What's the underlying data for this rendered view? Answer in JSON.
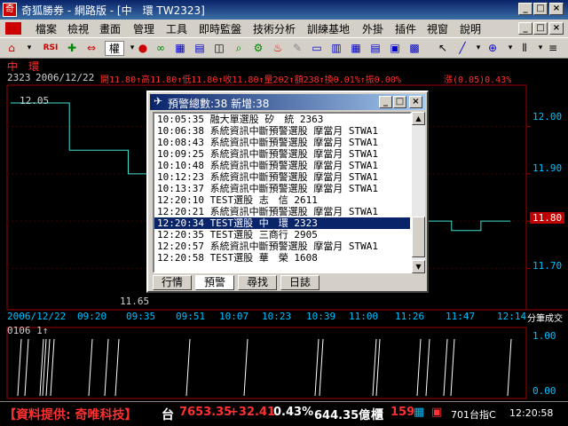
{
  "window": {
    "title": "奇狐勝券 - 網路版 - [中　環 TW2323]"
  },
  "menu": [
    "檔案",
    "檢視",
    "畫面",
    "管理",
    "工具",
    "即時監盤",
    "技術分析",
    "訓練基地",
    "外掛",
    "插件",
    "視窗",
    "說明"
  ],
  "toolbar": {
    "period_label": "權"
  },
  "chart_header": {
    "stock_name": "中　環",
    "code": "2323",
    "date": "2006/12/22",
    "ohlc_text": "開11.80↑高11.80↑低11.80↑收11.80↑量202↑額238↑換0.01%↑振0.00%",
    "change_text": "漲(0.05)0.43%"
  },
  "price_axis": {
    "labels": [
      "12.00",
      "11.90",
      "11.80",
      "11.70"
    ],
    "current_price": "11.80",
    "high_marker": "12.05",
    "low_marker": "11.65"
  },
  "time_axis": {
    "start_date": "2006/12/22",
    "ticks": [
      "09:20",
      "09:35",
      "09:51",
      "10:07",
      "10:23",
      "10:39",
      "11:00",
      "11:26",
      "11:47",
      "12:14"
    ],
    "right_label": "分筆成交"
  },
  "volume_panel": {
    "header": "0106 1↑",
    "labels": [
      "1.00",
      "0.00"
    ]
  },
  "chart_data": {
    "type": "line",
    "series": [
      {
        "values": [
          12.05,
          12.05,
          11.95,
          11.95,
          11.9,
          11.9,
          11.82,
          11.82,
          11.8,
          11.8,
          11.72,
          11.66,
          11.7,
          11.78,
          11.8,
          11.78,
          11.8,
          11.8
        ]
      }
    ],
    "ylim": [
      11.62,
      12.08
    ]
  },
  "dialog": {
    "title": "預警總數:38 新增:38",
    "rows": [
      "10:05:35 融大單選股 矽　統 2363",
      "10:06:38 系統資訊中斷預警選股 摩當月 STWA1",
      "10:08:43 系統資訊中斷預警選股 摩當月 STWA1",
      "10:09:25 系統資訊中斷預警選股 摩當月 STWA1",
      "10:10:48 系統資訊中斷預警選股 摩當月 STWA1",
      "10:12:23 系統資訊中斷預警選股 摩當月 STWA1",
      "10:13:37 系統資訊中斷預警選股 摩當月 STWA1",
      "12:20:10 TEST選股 志　信 2611",
      "12:20:21 系統資訊中斷預警選股 摩當月 STWA1",
      "12:20:34 TEST選股 中　環 2323",
      "12:20:35 TEST選股 三商行 2905",
      "12:20:57 系統資訊中斷預警選股 摩當月 STWA1",
      "12:20:58 TEST選股 華　榮 1608"
    ],
    "selected_index": 9,
    "tabs": [
      "行情",
      "預警",
      "尋找",
      "日誌"
    ],
    "active_tab": 1
  },
  "statusbar": {
    "source": "【資料提供: 奇唯科技】",
    "market": "台",
    "index": "7653.35",
    "change": "+32.41",
    "percent": "0.43%",
    "volume": "644.35億",
    "cabinet": "櫃",
    "cabinet_value": "159",
    "futures": "701台指C",
    "clock": "12:20:58"
  },
  "colors": {
    "accent_red": "#ff2020",
    "price_line": "#40e0d0",
    "axis": "#a00000",
    "label_blue": "#00c0ff",
    "selected": "#0a246a"
  }
}
